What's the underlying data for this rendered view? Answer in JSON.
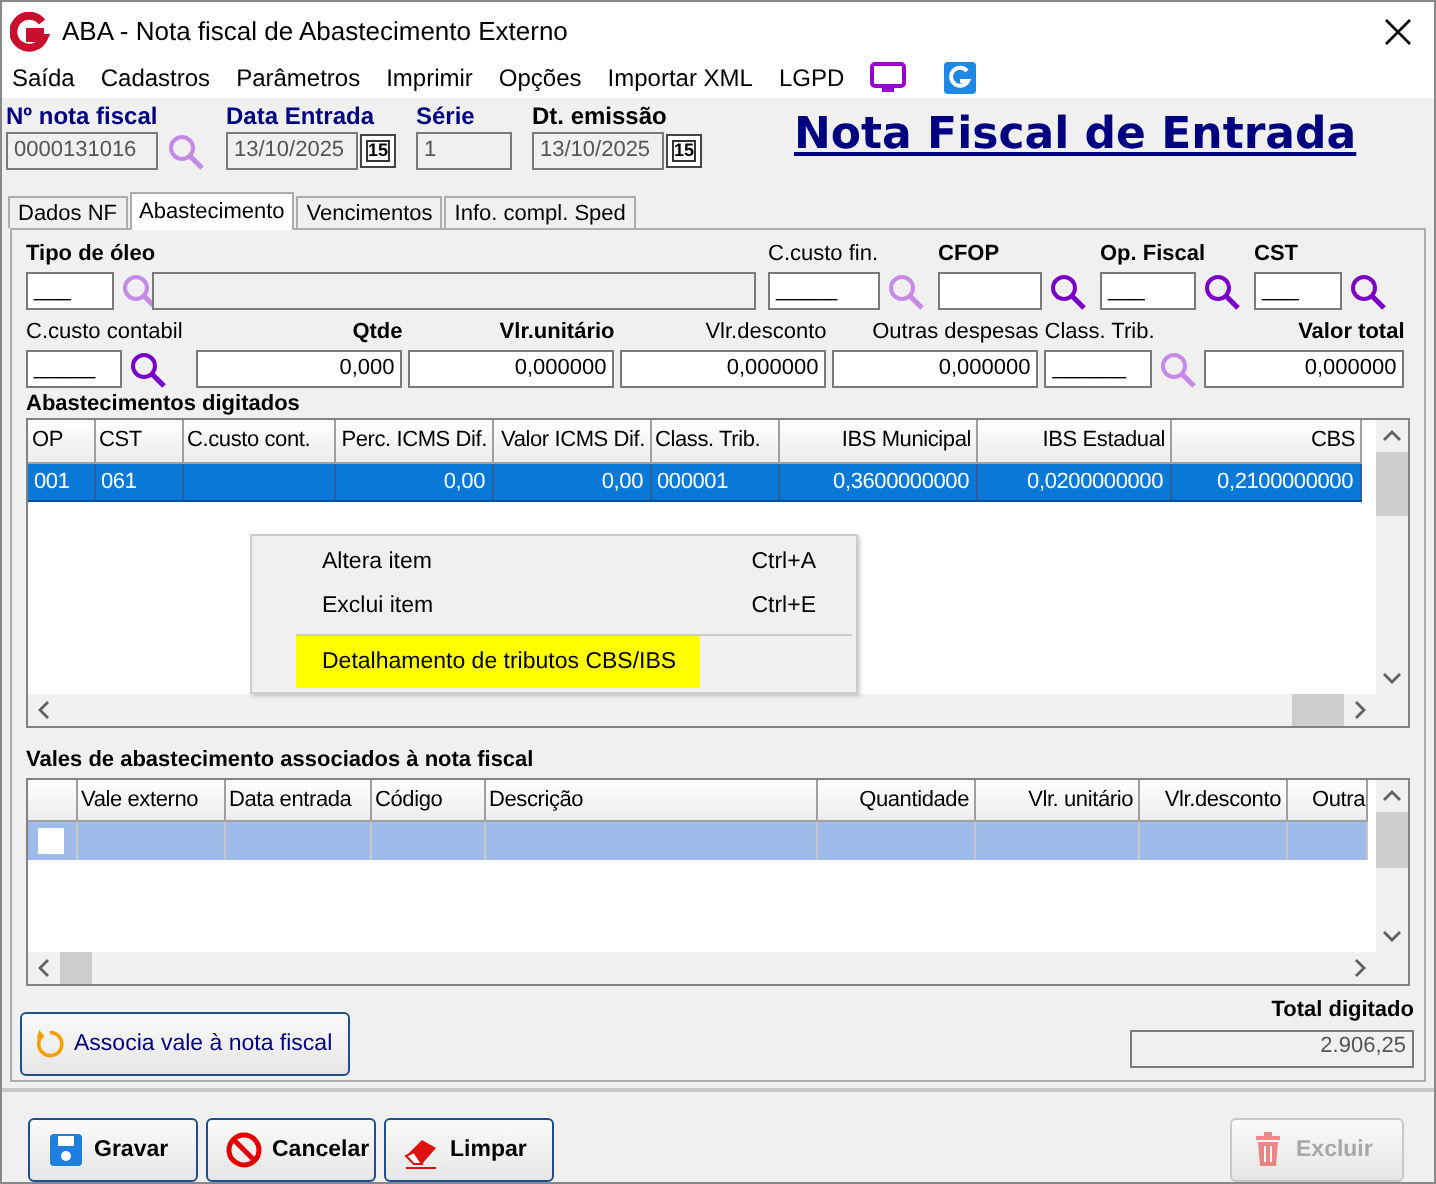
{
  "window": {
    "title": "ABA - Nota fiscal de Abastecimento Externo"
  },
  "menu": [
    {
      "label": "Saída"
    },
    {
      "label": "Cadastros"
    },
    {
      "label": "Parâmetros"
    },
    {
      "label": "Imprimir"
    },
    {
      "label": "Opções"
    },
    {
      "label": "Importar XML"
    },
    {
      "label": "LGPD"
    }
  ],
  "header": {
    "fields": [
      {
        "label": "Nº nota fiscal",
        "value": "0000131016",
        "kind": "lookup",
        "disabled": true
      },
      {
        "label": "Data Entrada",
        "value": "13/10/2025",
        "kind": "date",
        "button_text": "15",
        "disabled": true
      },
      {
        "label": "Série",
        "value": "1",
        "kind": "text",
        "disabled": true
      },
      {
        "label": "Dt. emissão",
        "value": "13/10/2025",
        "kind": "date",
        "button_text": "15",
        "disabled": true
      }
    ],
    "title_link": "Nota Fiscal de Entrada"
  },
  "tabs": [
    {
      "label": "Dados NF",
      "selected": false
    },
    {
      "label": "Abastecimento",
      "selected": true
    },
    {
      "label": "Vencimentos",
      "selected": false
    },
    {
      "label": "Info. compl. Sped",
      "selected": false
    }
  ],
  "form_rows": [
    [
      {
        "label": "Tipo de óleo",
        "bold": true,
        "value": "___",
        "lookup_active": false,
        "disabled": false
      },
      {
        "disabled": true
      },
      {
        "label": "C.custo fin.",
        "bold": false,
        "value": "_____",
        "lookup_active": false,
        "disabled": false
      },
      {
        "label": "CFOP",
        "bold": true,
        "lookup_active": true,
        "disabled": false
      },
      {
        "label": "Op. Fiscal",
        "bold": true,
        "value": "___",
        "lookup_active": true,
        "disabled": false
      },
      {
        "label": "CST",
        "bold": true,
        "value": "___",
        "lookup_active": true,
        "disabled": false
      }
    ],
    [
      {
        "label": "C.custo contabil",
        "bold": false,
        "value": "_____",
        "lookup_active": true,
        "disabled": false
      },
      {
        "label": "Qtde",
        "bold": true,
        "value": "0,000",
        "disabled": false
      },
      {
        "label": "Vlr.unitário",
        "bold": true,
        "value": "0,000000",
        "disabled": false
      },
      {
        "label": "Vlr.desconto",
        "bold": false,
        "value": "0,000000",
        "disabled": false
      },
      {
        "label": "Outras despesas",
        "bold": false,
        "value": "0,000000",
        "disabled": false
      },
      {
        "label": "Class. Trib.",
        "bold": false,
        "value": "______",
        "lookup_active": false,
        "disabled": false
      },
      {
        "label": "Valor total",
        "bold": true,
        "value": "0,000000",
        "disabled": false
      }
    ]
  ],
  "fuel_entries": {
    "title": "Abastecimentos digitados",
    "columns": [
      "OP",
      "CST",
      "C.custo cont.",
      "Perc. ICMS Dif.",
      "Valor ICMS Dif.",
      "Class. Trib.",
      "IBS Municipal",
      "IBS Estadual",
      "CBS"
    ],
    "rows": [
      {
        "selected": true,
        "cells": [
          "001",
          "061",
          null,
          "0,00",
          "0,00",
          "000001",
          "0,3600000000",
          "0,0200000000",
          "0,2100000000"
        ]
      }
    ]
  },
  "context_menu": [
    {
      "kind": "item",
      "label": "Altera item",
      "shortcut": "Ctrl+A",
      "highlighted": false
    },
    {
      "kind": "item",
      "label": "Exclui item",
      "shortcut": "Ctrl+E",
      "highlighted": false
    },
    {
      "kind": "separator"
    },
    {
      "kind": "item",
      "label": "Detalhamento de tributos CBS/IBS",
      "highlighted": true
    }
  ],
  "vouchers": {
    "title": "Vales de abastecimento associados à nota fiscal",
    "columns": [
      "Vale externo",
      "Data entrada",
      "Código",
      "Descrição",
      "Quantidade",
      "Vlr. unitário",
      "Vlr.desconto",
      "Outra"
    ],
    "rows": [
      {
        "selected": true,
        "checked": false
      }
    ]
  },
  "associate_button": "Associa vale à nota fiscal",
  "total": {
    "label": "Total digitado",
    "value": "2.906,25"
  },
  "buttons": [
    {
      "label": "Gravar",
      "kind": "save",
      "disabled": false
    },
    {
      "label": "Cancelar",
      "kind": "cancel",
      "disabled": false
    },
    {
      "label": "Limpar",
      "kind": "clear",
      "disabled": false
    },
    {
      "label": "Excluir",
      "kind": "delete",
      "disabled": true
    }
  ]
}
